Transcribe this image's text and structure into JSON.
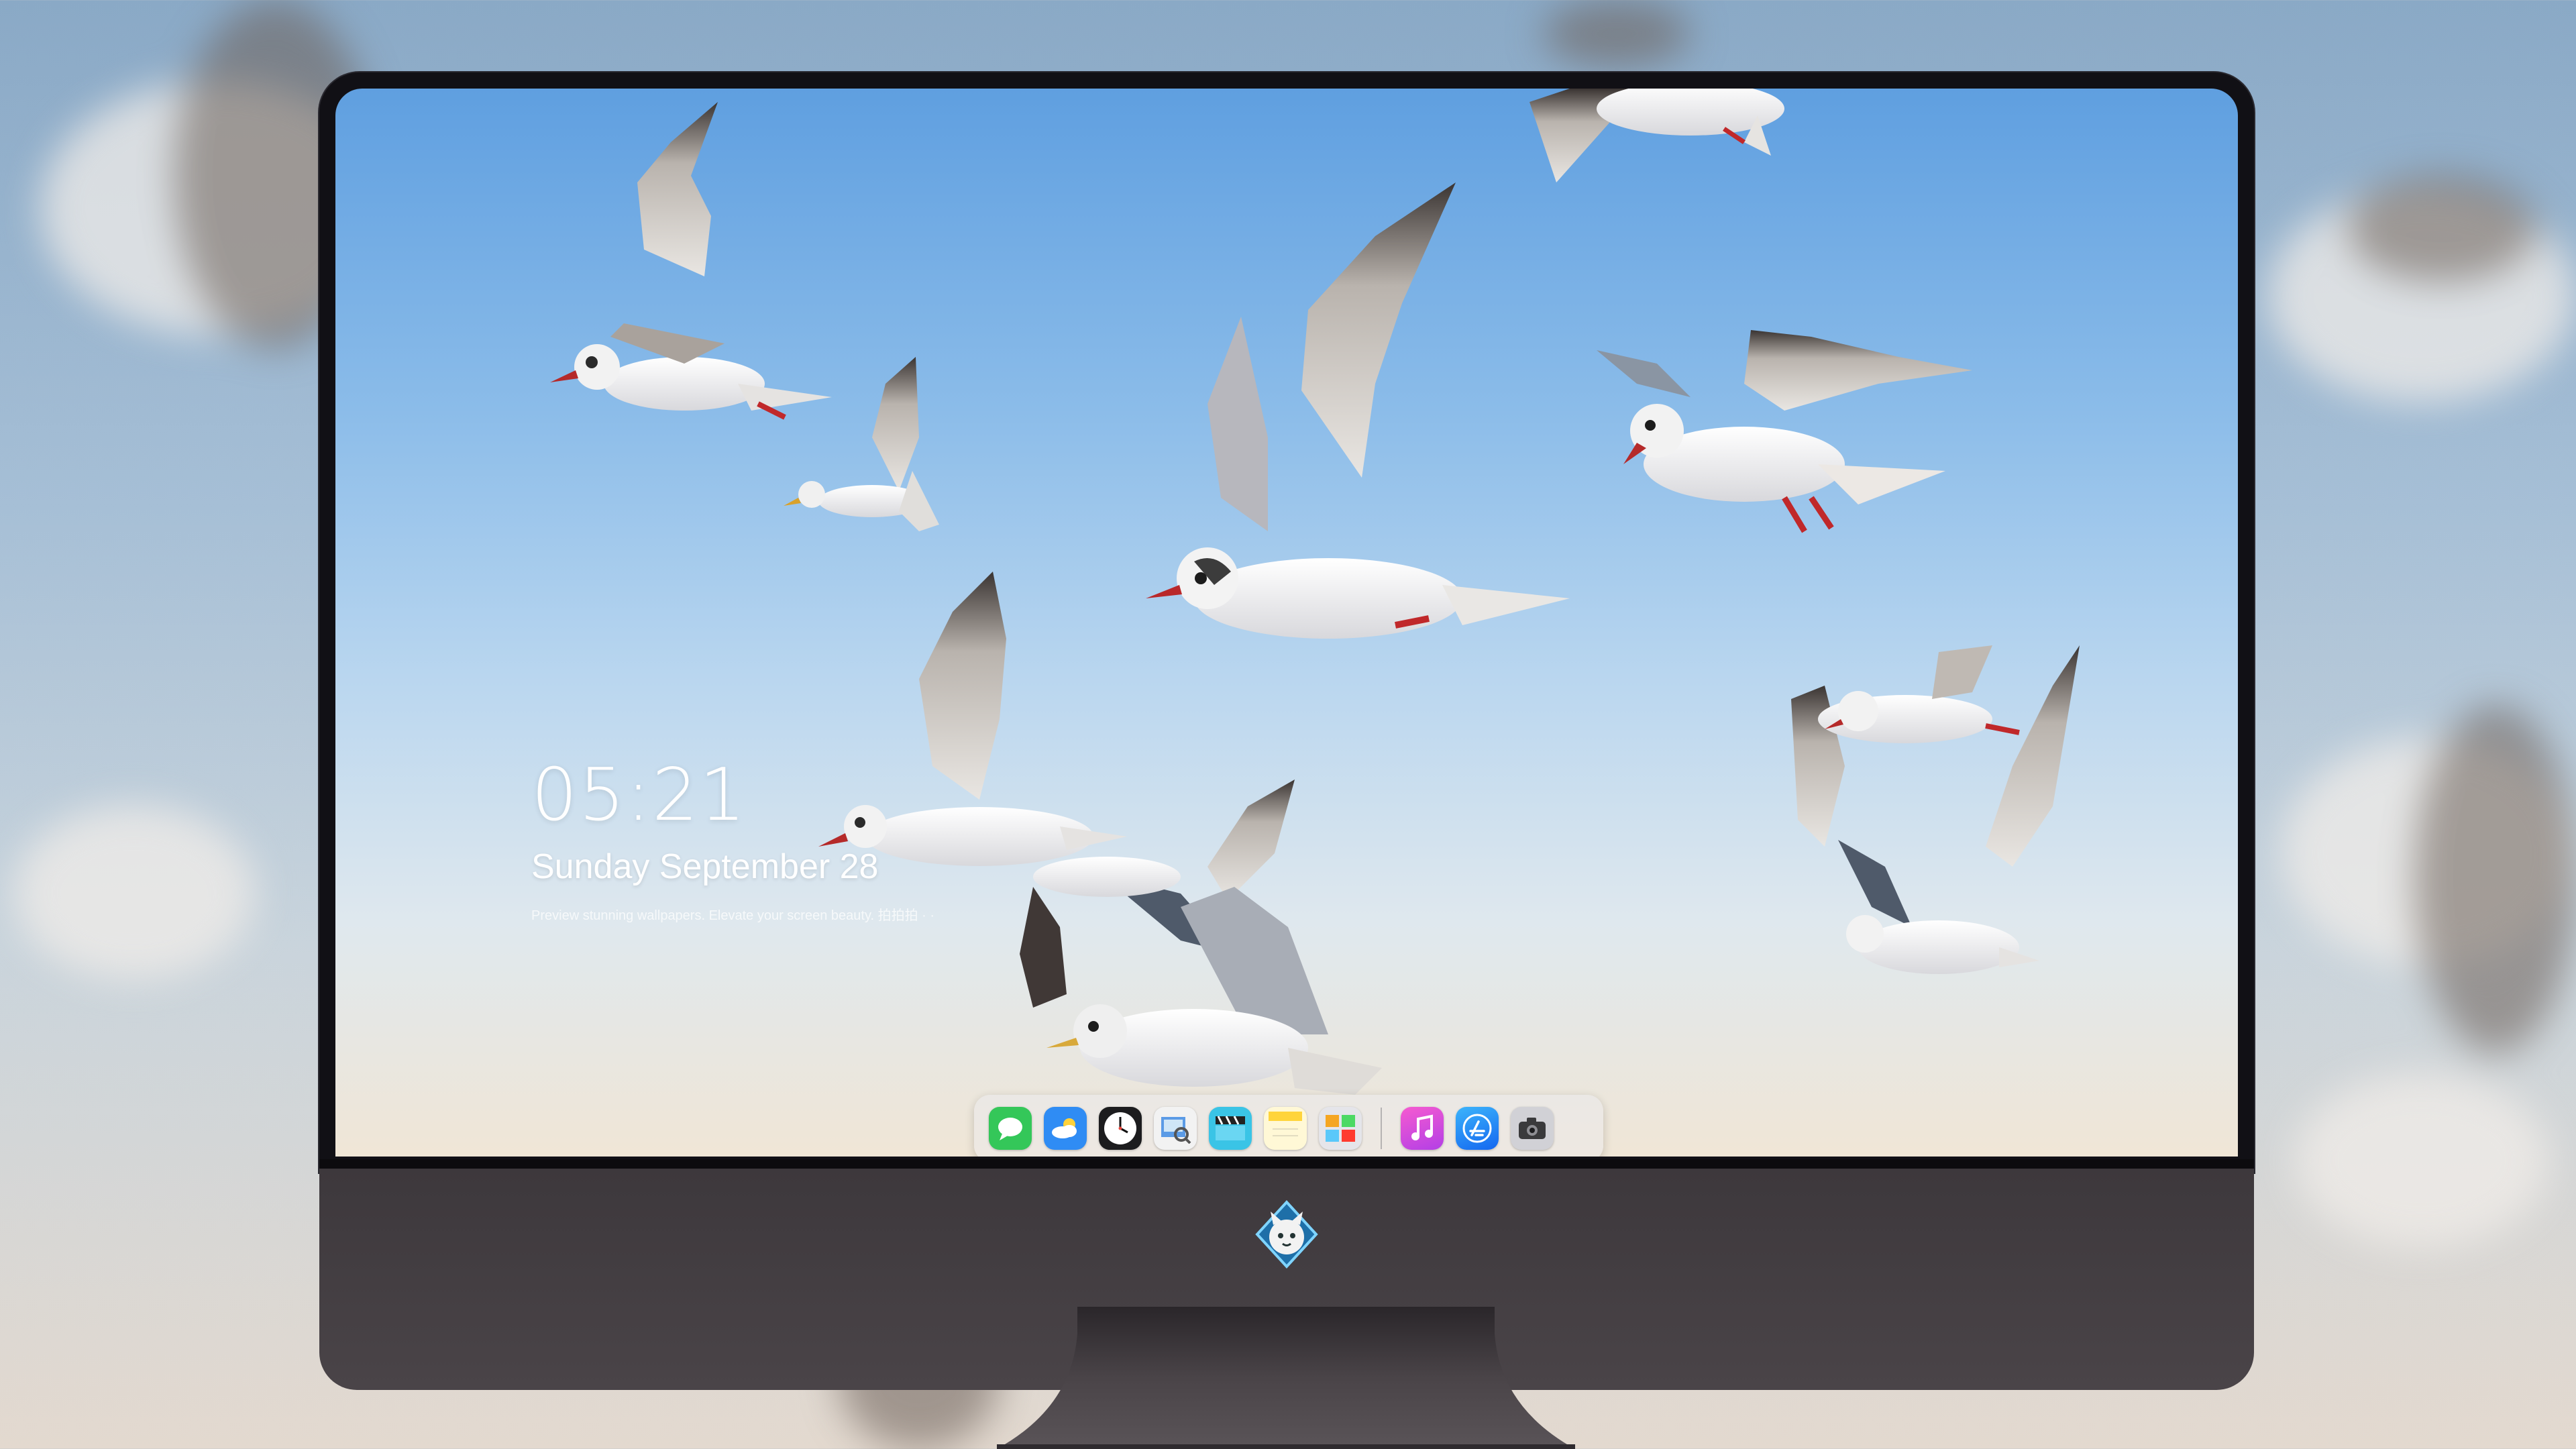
{
  "lockscreen": {
    "time": "05:21",
    "date": "Sunday September 28",
    "caption": "Preview stunning wallpapers. Elevate your screen beauty. 拍拍拍 · ·"
  },
  "dock": {
    "apps": [
      {
        "name": "Messages",
        "icon": "messages-icon",
        "color": "#34c759"
      },
      {
        "name": "Weather",
        "icon": "weather-icon",
        "color": "#2f8cf4"
      },
      {
        "name": "Clock",
        "icon": "clock-icon",
        "color": "#1c1c1e"
      },
      {
        "name": "Preview",
        "icon": "preview-icon",
        "color": "#f2f2f2"
      },
      {
        "name": "Clips",
        "icon": "clips-icon",
        "color": "#3ac4e6"
      },
      {
        "name": "Notes",
        "icon": "notes-icon",
        "color": "#ffd43b"
      },
      {
        "name": "Photo Booth",
        "icon": "photo-booth-icon",
        "color": "#d9d9d9"
      },
      {
        "name": "Music",
        "icon": "music-icon",
        "color": "#e44ad6"
      },
      {
        "name": "App Store",
        "icon": "app-store-icon",
        "color": "#1e8bf7"
      },
      {
        "name": "Camera",
        "icon": "camera-icon",
        "color": "#d1d1d6"
      }
    ]
  },
  "colors": {
    "sky_top": "#5f9fe0",
    "sky_bottom": "#f0e6d6",
    "bezel": "#111015",
    "chin": "#433e42"
  },
  "logo": {
    "icon": "fox-mascot-logo-icon"
  }
}
